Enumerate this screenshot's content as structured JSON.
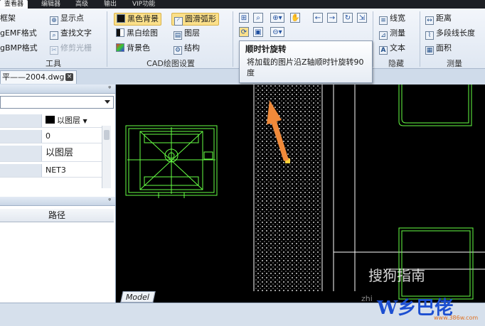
{
  "menu_tabs": [
    "查看器",
    "编辑器",
    "高级",
    "输出",
    "VIP功能"
  ],
  "ribbon": {
    "col1": [
      "框架",
      "EMF格式",
      "BMP格式"
    ],
    "col1_prefix2": "g",
    "col1_prefix3": "g",
    "group1_label": "工具",
    "col2": [
      "显示点",
      "查找文字",
      "修剪光栅"
    ],
    "col3": [
      "黑色背景",
      "黑白绘图",
      "背景色"
    ],
    "col4": [
      "圆滑弧形",
      "图层",
      "结构"
    ],
    "group2_label": "CAD绘图设置",
    "col6": [
      "线宽",
      "测量",
      "文本"
    ],
    "group4_label": "隐藏",
    "col7": [
      "距离",
      "多段线长度",
      "面积"
    ],
    "group5_label": "测量"
  },
  "tooltip": {
    "title": "顺时针旋转",
    "text": "将加载的图片沿Z轴顺时针旋转90度"
  },
  "document_tab": {
    "label": "平——2004.dwg",
    "close": "×"
  },
  "properties": {
    "pin": "ᵠ",
    "rows": [
      {
        "value": "以图层"
      },
      {
        "value": "0"
      },
      {
        "value": "以图层"
      },
      {
        "value": "NET3"
      }
    ]
  },
  "files_panel": {
    "pin": "ᵠ",
    "column_header": "路径"
  },
  "canvas": {
    "model_tab": "Model"
  },
  "watermark": {
    "sogou": "搜狗指南",
    "zhi": "zhi",
    "site_logo": "W乡巴佬",
    "site_url": "www.386w.com"
  },
  "colors": {
    "cad_green": "#66ff44",
    "arrow_orange": "#f08a3a",
    "canvas_bg": "#000000",
    "highlight": "#fbe08a"
  }
}
